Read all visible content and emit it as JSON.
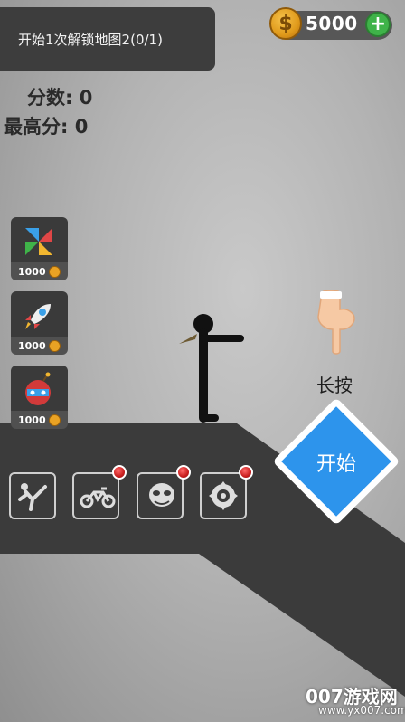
{
  "unlock_banner": {
    "text": "开始1次解锁地图2(0/1)"
  },
  "coins": {
    "count": "5000",
    "symbol": "$",
    "add_symbol": "+"
  },
  "score": {
    "label": "分数:",
    "value": "0"
  },
  "best": {
    "label": "最高分:",
    "value": "0"
  },
  "shop_items": [
    {
      "name": "pinwheel-icon",
      "price": "1000"
    },
    {
      "name": "rocket-icon",
      "price": "1000"
    },
    {
      "name": "bomb-icon",
      "price": "1000"
    }
  ],
  "skills": [
    {
      "name": "yoga-pose-icon",
      "locked": false
    },
    {
      "name": "motorcycle-icon",
      "locked": true
    },
    {
      "name": "mask-icon",
      "locked": true
    },
    {
      "name": "saw-blade-icon",
      "locked": true
    }
  ],
  "hint": {
    "label": "长按"
  },
  "start_button": {
    "label": "开始"
  },
  "watermark": {
    "brand": "007游戏网",
    "url": "www.yx007.com"
  },
  "colors": {
    "accent": "#2d94ec",
    "panel": "#3d3d3d",
    "coin": "#e09a1b",
    "add": "#3fb349",
    "lock": "#c81e1e"
  }
}
